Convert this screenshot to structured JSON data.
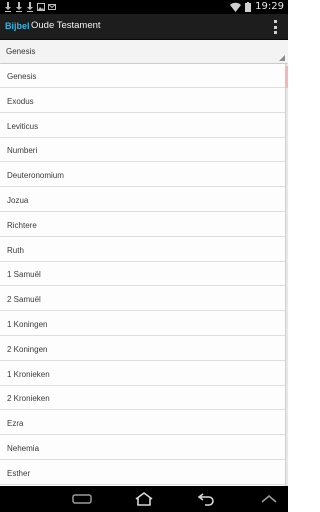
{
  "status_bar": {
    "time": "19:29",
    "notification_icons": [
      "download-icon",
      "download-icon",
      "download-icon",
      "image-icon",
      "email-icon"
    ],
    "system_icons": [
      "wifi-icon",
      "battery-icon"
    ]
  },
  "action_bar": {
    "app_badge": "Bijbel",
    "title": "Oude Testament",
    "overflow_icon": "more-vert-icon"
  },
  "spinner": {
    "selected": "Genesis"
  },
  "dropdown": {
    "items": [
      "Genesis",
      "Exodus",
      "Leviticus",
      "Numberi",
      "Deuteronomium",
      "Jozua",
      "Richtere",
      "Ruth",
      "1 Samuël",
      "2 Samuël",
      "1 Koningen",
      "2 Koningen",
      "1 Kronieken",
      "2 Kronieken",
      "Ezra",
      "Nehemia",
      "Esther"
    ]
  },
  "nav_bar": {
    "buttons": [
      "collapse-icon",
      "home-icon",
      "back-icon",
      "recent-apps-icon",
      "up-icon"
    ]
  },
  "colors": {
    "accent": "#33b5e5",
    "action_bar": "#1d1d1d",
    "status_bar": "#000000"
  }
}
